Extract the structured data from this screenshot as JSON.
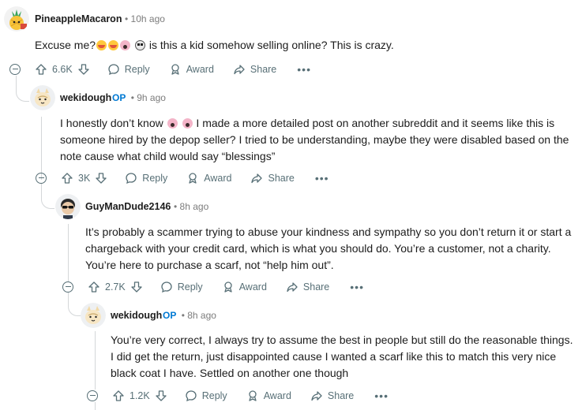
{
  "comments": [
    {
      "author": "PineappleMacaron",
      "op_badge": "",
      "time": "10h ago",
      "body_parts": [
        "Excuse me?",
        " is this a kid somehow selling online? This is crazy."
      ],
      "votes": "6.6K",
      "reply_label": "Reply",
      "award_label": "Award",
      "share_label": "Share",
      "more_label": "•••"
    },
    {
      "author": "wekidough",
      "op_badge": "OP",
      "time": "9h ago",
      "body_lines": [
        "I honestly don’t know",
        "I made a more detailed post on another subreddit and it seems like this is",
        "someone hired by the depop seller? I tried to be understanding, maybe they were disabled based on the",
        "note cause what child would say “blessings”"
      ],
      "votes": "3K",
      "reply_label": "Reply",
      "award_label": "Award",
      "share_label": "Share",
      "more_label": "•••"
    },
    {
      "author": "GuyManDude2146",
      "op_badge": "",
      "time": "8h ago",
      "body_lines": [
        "It’s probably a scammer trying to abuse your kindness and sympathy so you don’t return it or start a",
        "chargeback with your credit card, which is what you should do. You’re a customer, not a charity.",
        "You’re here to purchase a scarf, not “help him out”."
      ],
      "votes": "2.7K",
      "reply_label": "Reply",
      "award_label": "Award",
      "share_label": "Share",
      "more_label": "•••"
    },
    {
      "author": "wekidough",
      "op_badge": "OP",
      "time": "8h ago",
      "body_lines": [
        "You’re very correct, I always try to assume the best in people but still do the reasonable things.",
        "I did get the return, just disappointed cause I wanted a scarf like this to match this very nice",
        "black coat I have. Settled on another one though"
      ],
      "votes": "1.2K",
      "reply_label": "Reply",
      "award_label": "Award",
      "share_label": "Share",
      "more_label": "•••"
    }
  ],
  "separator": "•",
  "icons": {
    "upvote": "upvote-arrow-icon",
    "downvote": "downvote-arrow-icon",
    "reply": "speech-bubble-icon",
    "award": "award-ribbon-icon",
    "share": "share-arrow-icon",
    "collapse": "collapse-minus-icon"
  },
  "colors": {
    "op_badge": "#0079d3",
    "action_text": "#576f76",
    "thread_line": "#d4d7d9"
  }
}
